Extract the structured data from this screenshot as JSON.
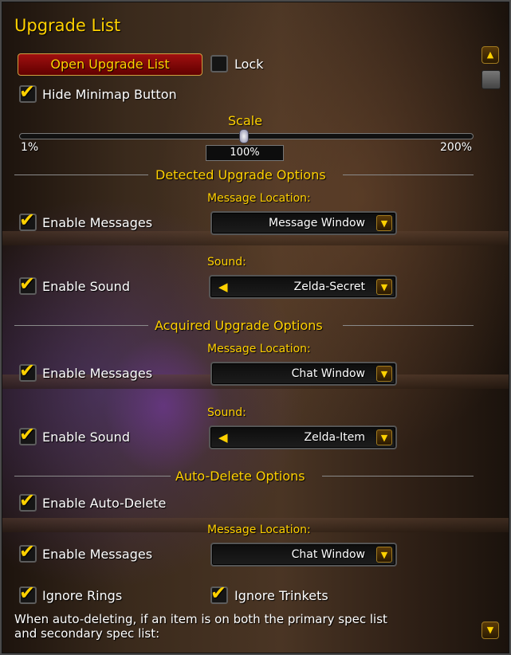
{
  "window": {
    "title": "Upgrade List"
  },
  "top": {
    "open_button_label": "Open Upgrade List",
    "lock_label": "Lock",
    "lock_checked": false,
    "hide_minimap_label": "Hide Minimap Button",
    "hide_minimap_checked": true
  },
  "scale": {
    "title": "Scale",
    "min_label": "1%",
    "max_label": "200%",
    "value_text": "100%",
    "value_fraction": 0.5
  },
  "detected": {
    "section_title": "Detected Upgrade Options",
    "message_location_label": "Message Location:",
    "enable_messages_label": "Enable Messages",
    "enable_messages_checked": true,
    "message_location_value": "Message Window",
    "sound_label": "Sound:",
    "enable_sound_label": "Enable Sound",
    "enable_sound_checked": true,
    "sound_value": "Zelda-Secret"
  },
  "acquired": {
    "section_title": "Acquired Upgrade Options",
    "message_location_label": "Message Location:",
    "enable_messages_label": "Enable Messages",
    "enable_messages_checked": true,
    "message_location_value": "Chat Window",
    "sound_label": "Sound:",
    "enable_sound_label": "Enable Sound",
    "enable_sound_checked": true,
    "sound_value": "Zelda-Item"
  },
  "autodelete": {
    "section_title": "Auto-Delete Options",
    "enable_autodelete_label": "Enable Auto-Delete",
    "enable_autodelete_checked": true,
    "message_location_label": "Message Location:",
    "enable_messages_label": "Enable Messages",
    "enable_messages_checked": true,
    "message_location_value": "Chat Window",
    "ignore_rings_label": "Ignore Rings",
    "ignore_rings_checked": true,
    "ignore_trinkets_label": "Ignore Trinkets",
    "ignore_trinkets_checked": true,
    "description": "When auto-deleting, if an item is on both the primary spec list and secondary spec list:"
  },
  "icons": {
    "check": "checkmark-icon",
    "dropdown_arrow": "chevron-down-icon",
    "speaker": "speaker-icon",
    "scroll_up": "scroll-up-icon",
    "scroll_down": "scroll-down-icon"
  },
  "colors": {
    "accent_gold": "#ffd100",
    "button_red": "#a01010"
  }
}
